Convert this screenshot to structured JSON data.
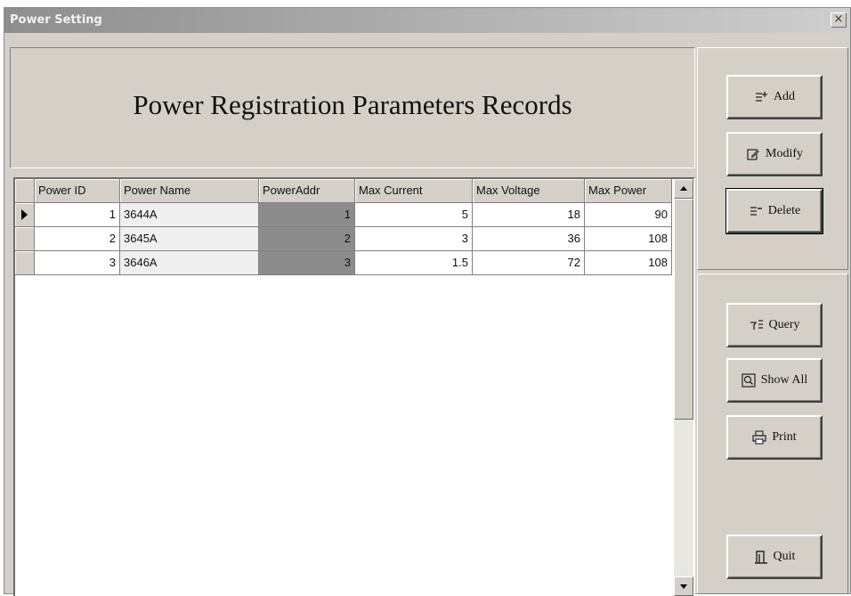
{
  "window": {
    "title": "Power Setting",
    "close_glyph": "×"
  },
  "header": {
    "title": "Power Registration Parameters Records"
  },
  "grid": {
    "columns": [
      "Power ID",
      "Power Name",
      "PowerAddr",
      "Max Current",
      "Max Voltage",
      "Max Power"
    ],
    "rows": [
      [
        "1",
        "3644A",
        "1",
        "5",
        "18",
        "90"
      ],
      [
        "2",
        "3645A",
        "2",
        "3",
        "36",
        "108"
      ],
      [
        "3",
        "3646A",
        "3",
        "1.5",
        "72",
        "108"
      ]
    ],
    "selected_row": 0
  },
  "buttons": {
    "add": "Add",
    "modify": "Modify",
    "delete": "Delete",
    "query": "Query",
    "show_all": "Show All",
    "print": "Print",
    "quit": "Quit"
  },
  "icons": {
    "add": "add-icon",
    "modify": "modify-icon",
    "delete": "delete-icon",
    "query": "query-icon",
    "show_all": "show-all-icon",
    "print": "printer-icon",
    "quit": "quit-icon"
  },
  "colors": {
    "title_bar_start": "#8e8e8e",
    "title_bar_end": "#cfcfcf",
    "addr_column_bg": "#8c8c8c",
    "face": "#d4d0c8"
  }
}
